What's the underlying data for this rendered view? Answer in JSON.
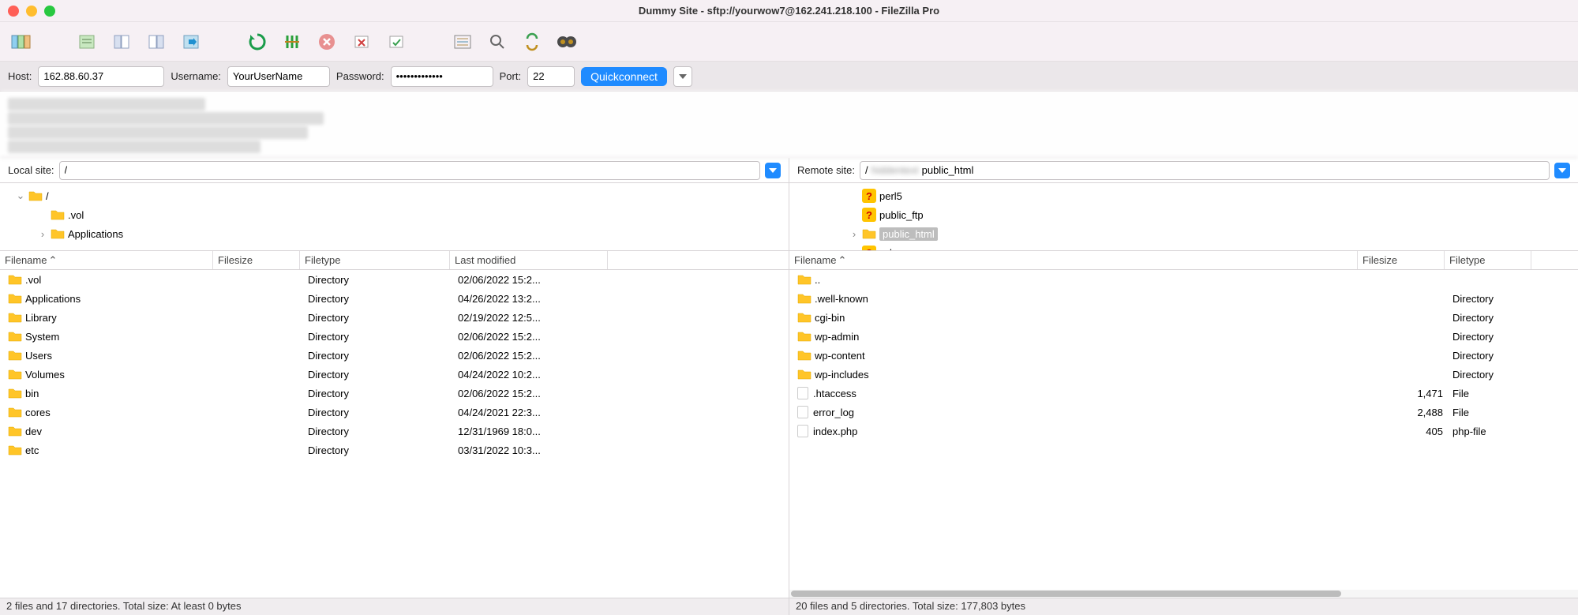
{
  "window": {
    "title": "Dummy Site - sftp://yourwow7@162.241.218.100 - FileZilla Pro"
  },
  "quickconnect": {
    "host_label": "Host:",
    "host_value": "162.88.60.37",
    "user_label": "Username:",
    "user_value": "YourUserName",
    "pass_label": "Password:",
    "pass_value": "•••••••••••••",
    "port_label": "Port:",
    "port_value": "22",
    "button": "Quickconnect"
  },
  "local": {
    "label": "Local site:",
    "path": "/",
    "tree": [
      {
        "indent": 0,
        "expand": "⌄",
        "icon": "folder",
        "name": "/"
      },
      {
        "indent": 1,
        "expand": "",
        "icon": "folder",
        "name": ".vol"
      },
      {
        "indent": 1,
        "expand": "›",
        "icon": "folder",
        "name": "Applications"
      }
    ],
    "columns": {
      "name": "Filename",
      "size": "Filesize",
      "type": "Filetype",
      "modified": "Last modified"
    },
    "files": [
      {
        "icon": "folder",
        "name": ".vol",
        "size": "",
        "type": "Directory",
        "modified": "02/06/2022 15:2..."
      },
      {
        "icon": "folder",
        "name": "Applications",
        "size": "",
        "type": "Directory",
        "modified": "04/26/2022 13:2..."
      },
      {
        "icon": "folder",
        "name": "Library",
        "size": "",
        "type": "Directory",
        "modified": "02/19/2022 12:5..."
      },
      {
        "icon": "folder",
        "name": "System",
        "size": "",
        "type": "Directory",
        "modified": "02/06/2022 15:2..."
      },
      {
        "icon": "folder",
        "name": "Users",
        "size": "",
        "type": "Directory",
        "modified": "02/06/2022 15:2..."
      },
      {
        "icon": "folder",
        "name": "Volumes",
        "size": "",
        "type": "Directory",
        "modified": "04/24/2022 10:2..."
      },
      {
        "icon": "folder",
        "name": "bin",
        "size": "",
        "type": "Directory",
        "modified": "02/06/2022 15:2..."
      },
      {
        "icon": "folder",
        "name": "cores",
        "size": "",
        "type": "Directory",
        "modified": "04/24/2021 22:3..."
      },
      {
        "icon": "folder",
        "name": "dev",
        "size": "",
        "type": "Directory",
        "modified": "12/31/1969 18:0..."
      },
      {
        "icon": "folder",
        "name": "etc",
        "size": "",
        "type": "Directory",
        "modified": "03/31/2022 10:3..."
      }
    ],
    "status": "2 files and 17 directories. Total size: At least 0 bytes"
  },
  "remote": {
    "label": "Remote site:",
    "path_prefix": "/",
    "path_suffix": "public_html",
    "tree": [
      {
        "indent": 2,
        "expand": "",
        "icon": "unknown",
        "name": "perl5",
        "selected": false
      },
      {
        "indent": 2,
        "expand": "",
        "icon": "unknown",
        "name": "public_ftp",
        "selected": false
      },
      {
        "indent": 2,
        "expand": "›",
        "icon": "folder",
        "name": "public_html",
        "selected": true
      },
      {
        "indent": 2,
        "expand": "",
        "icon": "unknown",
        "name": "ssl",
        "selected": false
      }
    ],
    "columns": {
      "name": "Filename",
      "size": "Filesize",
      "type": "Filetype"
    },
    "files": [
      {
        "icon": "folder",
        "name": "..",
        "size": "",
        "type": ""
      },
      {
        "icon": "folder",
        "name": ".well-known",
        "size": "",
        "type": "Directory"
      },
      {
        "icon": "folder",
        "name": "cgi-bin",
        "size": "",
        "type": "Directory"
      },
      {
        "icon": "folder",
        "name": "wp-admin",
        "size": "",
        "type": "Directory"
      },
      {
        "icon": "folder",
        "name": "wp-content",
        "size": "",
        "type": "Directory"
      },
      {
        "icon": "folder",
        "name": "wp-includes",
        "size": "",
        "type": "Directory"
      },
      {
        "icon": "file",
        "name": ".htaccess",
        "size": "1,471",
        "type": "File"
      },
      {
        "icon": "file",
        "name": "error_log",
        "size": "2,488",
        "type": "File"
      },
      {
        "icon": "file",
        "name": "index.php",
        "size": "405",
        "type": "php-file"
      }
    ],
    "status": "20 files and 5 directories. Total size: 177,803 bytes"
  }
}
